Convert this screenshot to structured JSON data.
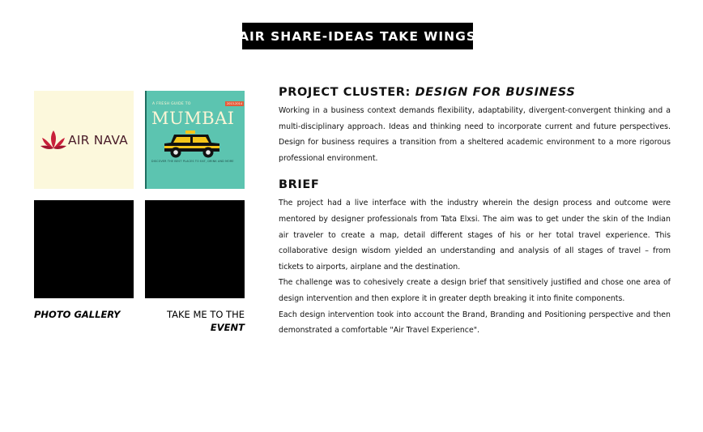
{
  "header": {
    "title": "AIR SHARE-IDEAS TAKE WINGS"
  },
  "gallery": {
    "tiles": [
      {
        "brand": "AIR NAVA",
        "colors": {
          "background": "#fcf8dc",
          "logo": "#c8203a",
          "text": "#4a1d2a"
        }
      },
      {
        "kicker": "A FRESH GUIDE TO",
        "tag": "2013-2014",
        "title": "MUMBAI",
        "footer": "DISCOVER THE BEST PLACES TO EAT, DRINK AND MORE",
        "colors": {
          "background": "#5cc4b0",
          "text": "#fdf5d6"
        }
      }
    ],
    "photo_caption": "PHOTO GALLERY",
    "event_caption_line1": "TAKE ME TO THE",
    "event_caption_line2": "EVENT"
  },
  "project": {
    "heading_prefix": "PROJECT CLUSTER: ",
    "heading_emphasis": "DESIGN FOR BUSINESS",
    "description": "Working in a business context demands flexibility, adaptability, divergent-convergent thinking and a multi-disciplinary approach. Ideas and thinking need to incorporate current and future perspectives. Design for business requires a transition from a sheltered academic environment to a more rigorous professional environment."
  },
  "brief": {
    "heading": "BRIEF",
    "paragraphs": [
      "The project had a live interface with the industry wherein the design process and outcome were mentored by designer professionals from Tata Elxsi. The aim was to get under the skin of the Indian air traveler to create a map, detail different stages of his or her total travel experience. This collaborative design wisdom yielded an understanding and analysis of all stages of travel – from tickets to airports, airplane and the destination.",
      "The challenge was to cohesively create a design brief that sensitively justified and chose one area of design intervention and then explore it in greater depth breaking it into finite components.",
      "Each design intervention took into account the Brand, Branding and Positioning perspective and then demonstrated a comfortable \"Air Travel Experience\"."
    ]
  }
}
